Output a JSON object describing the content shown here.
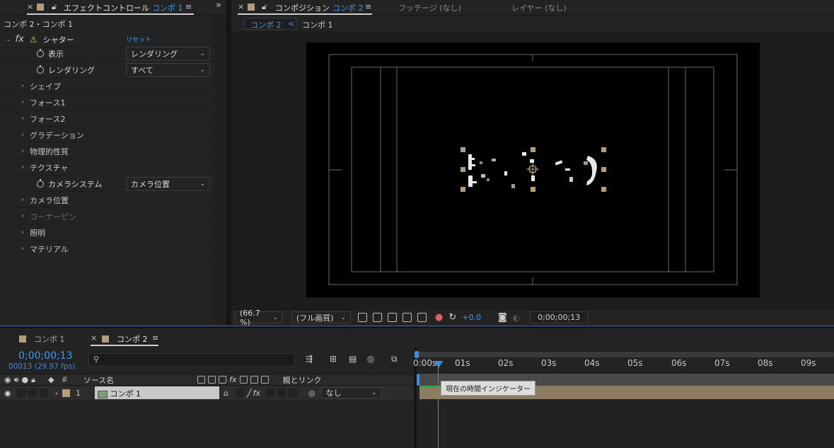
{
  "effect_panel": {
    "tab_close": "×",
    "tab_title": "エフェクトコントロール",
    "tab_comp": "コンポ 1",
    "tab_menu": "≡",
    "expand": "»",
    "breadcrumb": "コンポ 2・コンポ 1",
    "fx_label": "fx",
    "effect_name": "シャター",
    "reset_label": "リセット",
    "props": [
      {
        "label": "表示",
        "value": "レンダリング"
      },
      {
        "label": "レンダリング",
        "value": "すべて"
      }
    ],
    "groups": [
      "シェイプ",
      "フォース1",
      "フォース2",
      "グラデーション",
      "物理的性質",
      "テクスチャ"
    ],
    "camera_system": {
      "label": "カメラシステム",
      "value": "カメラ位置"
    },
    "groups2": [
      {
        "label": "カメラ位置",
        "disabled": false
      },
      {
        "label": "コーナーピン",
        "disabled": true
      },
      {
        "label": "照明",
        "disabled": false
      },
      {
        "label": "マテリアル",
        "disabled": false
      }
    ]
  },
  "comp_panel": {
    "tab_close": "×",
    "tab_title": "コンポジション",
    "tab_comp": "コンポ 2",
    "tab_menu": "≡",
    "footage_tab": "フッテージ (なし)",
    "layer_tab": "レイヤー (なし)",
    "sub_tabs": [
      "コンポ 2",
      "コンポ 1"
    ],
    "sub_arrow": "<",
    "zoom": "(66.7 %)",
    "resolution": "(フル画質)",
    "exposure": "+0.0",
    "timecode": "0;00;00;13"
  },
  "timeline": {
    "tabs": [
      {
        "label": "コンポ 1",
        "close": ""
      },
      {
        "label": "コンポ 2",
        "close": "×"
      }
    ],
    "tab_menu": "≡",
    "timecode": "0;00;00;13",
    "frame_info": "00013 (29.97 fps)",
    "search_placeholder": "",
    "columns": {
      "hash": "#",
      "source_name": "ソース名",
      "parent_link": "親とリンク"
    },
    "layer": {
      "number": "1",
      "name": "コンポ 1",
      "parent": "なし"
    },
    "ruler_ticks": [
      "0:00s",
      "01s",
      "02s",
      "03s",
      "04s",
      "05s",
      "06s",
      "07s",
      "08s",
      "09s"
    ],
    "tooltip": "現在の時間インジケーター"
  },
  "colors": {
    "accent": "#3f9cf0",
    "label_tan": "#b69c79",
    "layer_bar": "#8c7d62"
  }
}
